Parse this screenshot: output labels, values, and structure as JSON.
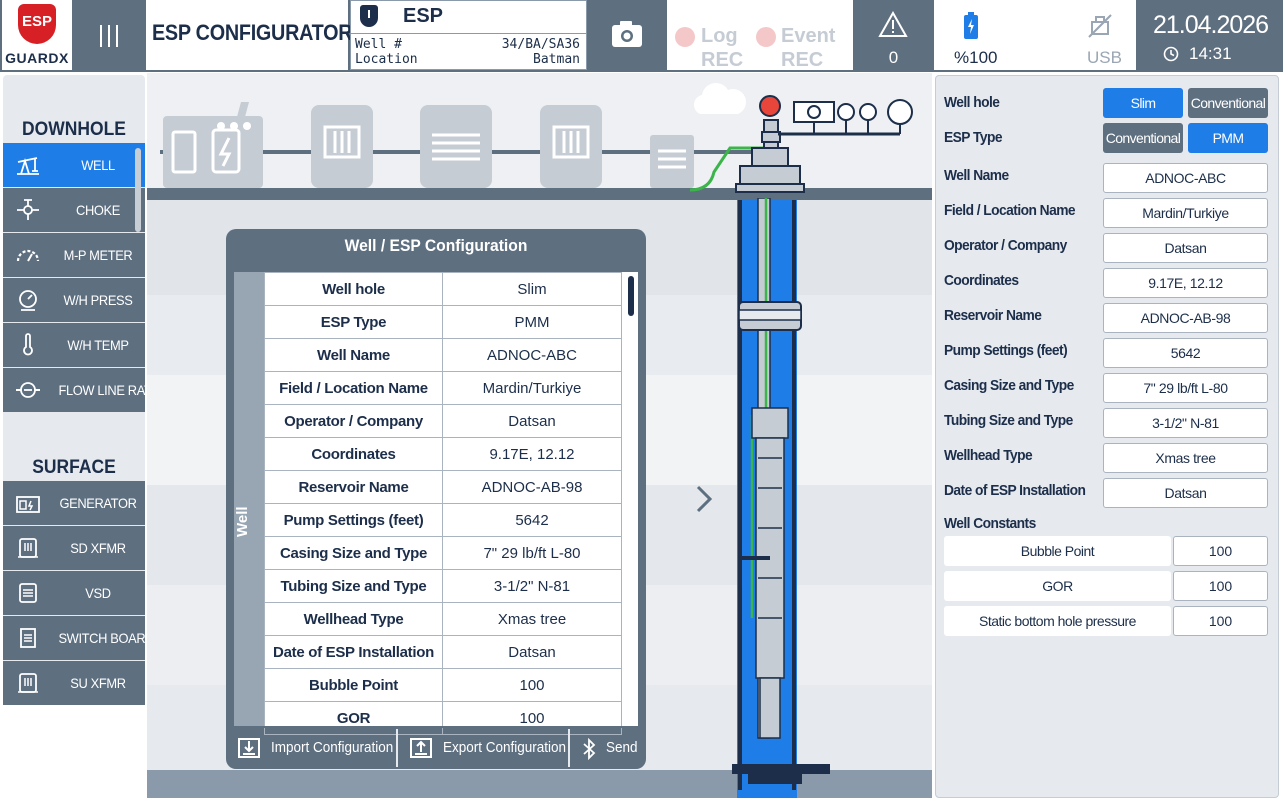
{
  "header": {
    "logo_badge": "ESP",
    "logo_text": "GUARDX",
    "app_title": "ESP CONFIGURATOR",
    "device_label": "ESP",
    "well_label": "Well #",
    "well_value": "34/BA/SA36",
    "location_label": "Location",
    "location_value": "Batman",
    "log_rec": [
      "Log",
      "REC"
    ],
    "event_rec": [
      "Event",
      "REC"
    ],
    "alert_count": "0",
    "battery": "%100",
    "usb": "USB",
    "date": "21.04.2026",
    "time": "14:31"
  },
  "sidebar": {
    "downhole_title": "DOWNHOLE",
    "downhole_items": [
      {
        "label": "WELL",
        "icon": "pumpjack-icon",
        "active": true
      },
      {
        "label": "CHOKE",
        "icon": "choke-icon",
        "active": false
      },
      {
        "label": "M-P METER",
        "icon": "gauge-icon",
        "active": false
      },
      {
        "label": "W/H PRESS",
        "icon": "pressure-icon",
        "active": false
      },
      {
        "label": "W/H TEMP",
        "icon": "thermometer-icon",
        "active": false
      },
      {
        "label": "FLOW LINE RATE",
        "icon": "flowmeter-icon",
        "active": false
      }
    ],
    "surface_title": "SURFACE",
    "surface_items": [
      {
        "label": "GENERATOR",
        "icon": "generator-icon"
      },
      {
        "label": "SD XFMR",
        "icon": "transformer-icon"
      },
      {
        "label": "VSD",
        "icon": "vsd-icon"
      },
      {
        "label": "SWITCH BOARD",
        "icon": "switchboard-icon"
      },
      {
        "label": "SU XFMR",
        "icon": "transformer-icon"
      }
    ]
  },
  "config": {
    "title": "Well / ESP Configuration",
    "side_label": "Well",
    "rows": [
      {
        "k": "Well hole",
        "v": "Slim"
      },
      {
        "k": "ESP Type",
        "v": "PMM"
      },
      {
        "k": "Well Name",
        "v": "ADNOC-ABC"
      },
      {
        "k": "Field / Location Name",
        "v": "Mardin/Turkiye"
      },
      {
        "k": "Operator / Company",
        "v": "Datsan"
      },
      {
        "k": "Coordinates",
        "v": "9.17E, 12.12"
      },
      {
        "k": "Reservoir Name",
        "v": "ADNOC-AB-98"
      },
      {
        "k": "Pump Settings (feet)",
        "v": "5642"
      },
      {
        "k": "Casing Size and Type",
        "v": "7\" 29 lb/ft L-80"
      },
      {
        "k": "Tubing Size and Type",
        "v": "3-1/2\" N-81"
      },
      {
        "k": "Wellhead Type",
        "v": "Xmas tree"
      },
      {
        "k": "Date of ESP Installation",
        "v": "Datsan"
      },
      {
        "k": "Bubble Point",
        "v": "100"
      },
      {
        "k": "GOR",
        "v": "100"
      }
    ],
    "import_label": "Import Configuration",
    "export_label": "Export Configuration",
    "send_label": "Send"
  },
  "form": {
    "well_hole_label": "Well hole",
    "well_hole_options": [
      "Slim",
      "Conventional"
    ],
    "well_hole_selected": "Slim",
    "esp_type_label": "ESP Type",
    "esp_type_options": [
      "Conventional",
      "PMM"
    ],
    "esp_type_selected": "PMM",
    "fields": [
      {
        "label": "Well Name",
        "value": "ADNOC-ABC"
      },
      {
        "label": "Field / Location Name",
        "value": "Mardin/Turkiye"
      },
      {
        "label": "Operator / Company",
        "value": "Datsan"
      },
      {
        "label": "Coordinates",
        "value": "9.17E, 12.12"
      },
      {
        "label": "Reservoir Name",
        "value": "ADNOC-AB-98"
      },
      {
        "label": "Pump Settings (feet)",
        "value": "5642"
      },
      {
        "label": "Casing Size and Type",
        "value": "7\" 29 lb/ft L-80"
      },
      {
        "label": "Tubing Size and Type",
        "value": "3-1/2\" N-81"
      },
      {
        "label": "Wellhead Type",
        "value": "Xmas tree"
      },
      {
        "label": "Date of ESP Installation",
        "value": "Datsan"
      }
    ],
    "constants_title": "Well Constants",
    "constants": [
      {
        "label": "Bubble Point",
        "value": "100"
      },
      {
        "label": "GOR",
        "value": "100"
      },
      {
        "label": "Static bottom hole pressure",
        "value": "100"
      }
    ]
  },
  "colors": {
    "header_bg": "#5e6f80",
    "accent_blue": "#1e7de6",
    "navy_text": "#1c2e4a",
    "brand_red": "#d71f26",
    "panel_bg": "#e6e9ee",
    "tubing_green": "#3bb54a"
  }
}
